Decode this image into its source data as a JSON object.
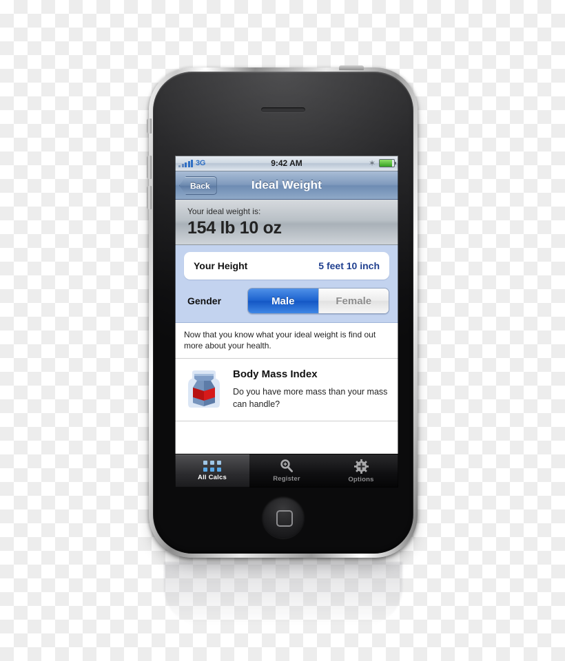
{
  "device": {
    "name": "iPhone 3GS",
    "home_button": "home-button",
    "speaker": "earpiece-speaker"
  },
  "status_bar": {
    "carrier": "3G",
    "time": "9:42 AM",
    "signal_icon": "signal-bars-icon",
    "bluetooth_icon": "bluetooth-icon",
    "bluetooth_glyph": "✶",
    "battery_icon": "battery-icon"
  },
  "nav_bar": {
    "back_label": "Back",
    "title": "Ideal Weight"
  },
  "result": {
    "label": "Your ideal weight is:",
    "value": "154 lb 10 oz"
  },
  "form": {
    "height_label": "Your Height",
    "height_value": "5 feet 10 inch",
    "gender_label": "Gender",
    "segments": [
      {
        "label": "Male",
        "selected": true
      },
      {
        "label": "Female",
        "selected": false
      }
    ]
  },
  "note": "Now that you know what your ideal weight is find out more about your health.",
  "cell": {
    "icon": "body-mass-weight-icon",
    "title": "Body Mass Index",
    "subtitle": "Do you have more mass than your mass can handle?"
  },
  "tab_bar": {
    "tabs": [
      {
        "label": "All Calcs",
        "icon": "grid-icon",
        "active": true
      },
      {
        "label": "Register",
        "icon": "key-plus-icon",
        "active": false
      },
      {
        "label": "Options",
        "icon": "gear-plus-icon",
        "active": false
      }
    ]
  },
  "colors": {
    "accent_blue": "#1d63cf",
    "form_bg": "#c3d3ef",
    "value_blue": "#1f3f8f",
    "battery_green": "#35a022",
    "carrier_blue": "#2d6ec4"
  }
}
